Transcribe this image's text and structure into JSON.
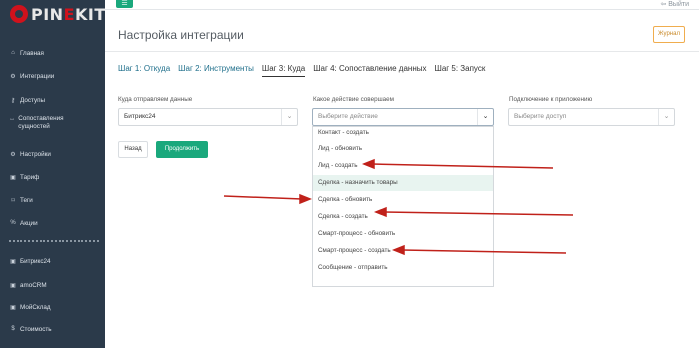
{
  "brand": {
    "logo_prefix": "PIN",
    "logo_suffix": "E",
    "logo_rest": "KIT"
  },
  "topbar": {
    "menu_icon": "☰",
    "exit_label": "⇦ Выйти"
  },
  "sidebar": {
    "items": [
      {
        "icon": "⌂",
        "label": "Главная"
      },
      {
        "icon": "⚙",
        "label": "Интеграции"
      },
      {
        "icon": "⚷",
        "label": "Доступы"
      },
      {
        "icon": "↔",
        "label": "Сопоставления сущностей"
      },
      {
        "icon": "⚙",
        "label": "Настройки"
      },
      {
        "icon": "▣",
        "label": "Тариф"
      },
      {
        "icon": "⌑",
        "label": "Теги"
      },
      {
        "icon": "%",
        "label": "Акции"
      },
      {
        "icon": "▣",
        "label": "Битрикс24"
      },
      {
        "icon": "▣",
        "label": "amoCRM"
      },
      {
        "icon": "▣",
        "label": "МойСклад"
      },
      {
        "icon": "$",
        "label": "Стоимость"
      }
    ]
  },
  "page": {
    "title": "Настройка интеграции",
    "journal_button": "Журнал",
    "tabs": [
      "Шаг 1: Откуда",
      "Шаг 2: Инструменты",
      "Шаг 3: Куда",
      "Шаг 4: Сопоставление данных",
      "Шаг 5: Запуск"
    ]
  },
  "form": {
    "target_label": "Куда отправляем данные",
    "target_value": "Битрикс24",
    "action_label": "Какое действие совершаем",
    "action_placeholder": "Выберите действие",
    "connection_label": "Подключение к приложению",
    "connection_placeholder": "Выберите доступ",
    "back_button": "Назад",
    "next_button": "Продолжить"
  },
  "dropdown": {
    "options": [
      "Контакт - создать",
      "Лид - обновить",
      "Лид - создать",
      "Сделка - назначить товары",
      "Сделка - обновить",
      "Сделка - создать",
      "Смарт-процесс - обновить",
      "Смарт-процесс - создать",
      "Сообщение - отправить"
    ],
    "highlighted_index": 3
  },
  "colors": {
    "accent": "#1aa87c",
    "sidebar": "#2b3a4a",
    "annotation_arrow": "#c0211a"
  }
}
